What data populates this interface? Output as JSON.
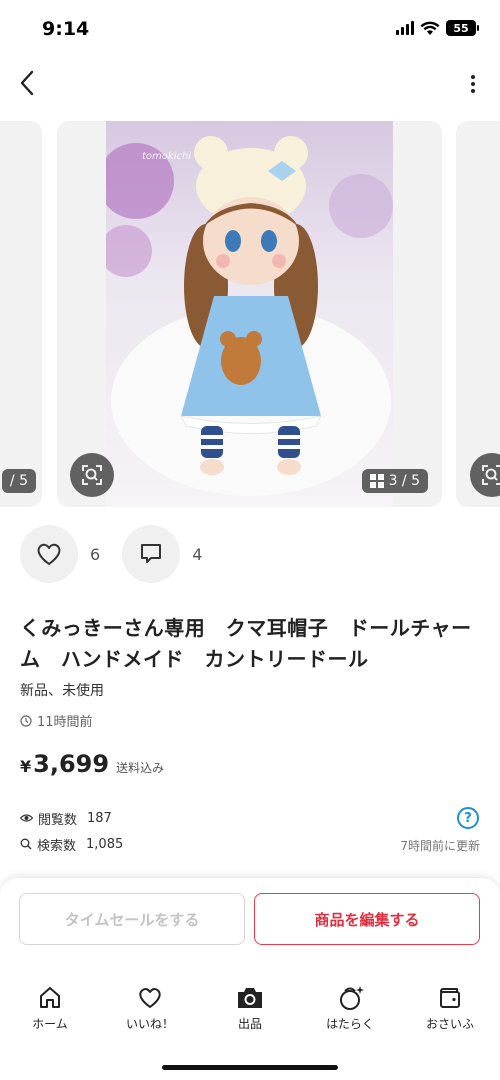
{
  "status_bar": {
    "time": "9:14",
    "battery": "55"
  },
  "carousel": {
    "prev_counter": "/ 5",
    "main_counter": "3 / 5",
    "watermark": "tomokichi"
  },
  "actions": {
    "like_count": "6",
    "comment_count": "4"
  },
  "item": {
    "title": "くみっきーさん専用　クマ耳帽子　ドールチャーム　ハンドメイド　カントリードール",
    "condition": "新品、未使用",
    "posted": "11時間前",
    "price_symbol": "¥",
    "price": "3,699",
    "shipping": "送料込み"
  },
  "stats": {
    "views_label": "閲覧数",
    "views": "187",
    "search_label": "検索数",
    "searches": "1,085",
    "help": "?",
    "updated": "7時間前に更新"
  },
  "buttons": {
    "timesale": "タイムセールをする",
    "edit": "商品を編集する"
  },
  "tabs": [
    {
      "label": "ホーム",
      "icon": "home-icon"
    },
    {
      "label": "いいね！",
      "icon": "heart-icon"
    },
    {
      "label": "出品",
      "icon": "camera-icon"
    },
    {
      "label": "はたらく",
      "icon": "work-icon"
    },
    {
      "label": "おさいふ",
      "icon": "wallet-icon"
    }
  ],
  "colors": {
    "accent_red": "#e0303f",
    "help_blue": "#1e8fd6"
  }
}
